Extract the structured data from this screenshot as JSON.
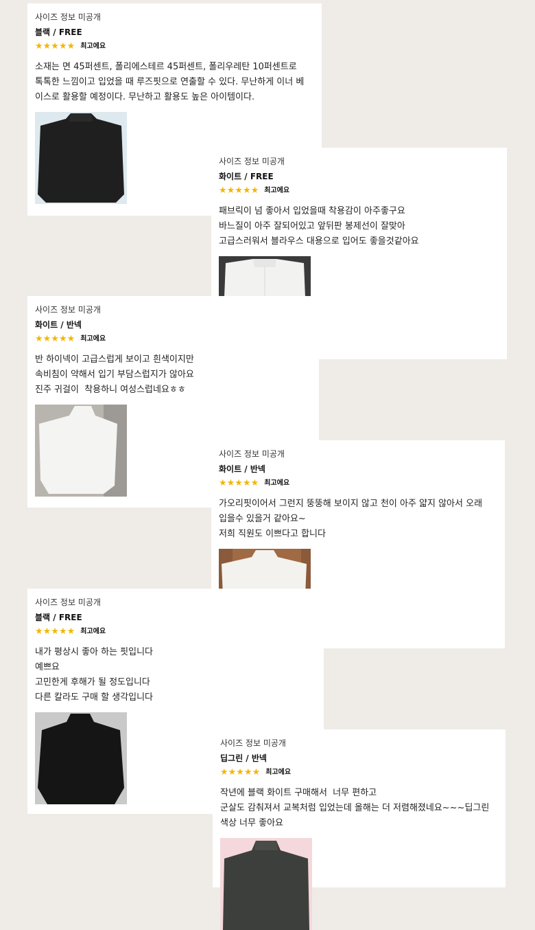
{
  "reviews": [
    {
      "size_info": "사이즈 정보 미공개",
      "option": "블랙 / FREE",
      "stars": "★★★★★",
      "rating_label": "최고에요",
      "text": "소재는 면 45퍼센트, 폴리에스테르 45퍼센트, 폴리우레탄 10퍼센트로\n톡톡한 느낌이고 입었을 때 루즈핏으로 연출할 수 있다. 무난하게 이너 베\n이스로 활용할 예정이다. 무난하고 활용도 높은 아이템이다.",
      "photo": "black-turtleneck-photo"
    },
    {
      "size_info": "사이즈 정보 미공개",
      "option": "화이트 / FREE",
      "stars": "★★★★★",
      "rating_label": "최고에요",
      "text": "패브릭이 넘 좋아서 입었을때 착용감이 아주좋구요\n바느질이 아주 잘되어있고 앞뒤판 봉제선이 잘맞아\n고급스러워서 블라우스 대용으로 입어도 좋을것같아요",
      "photo": "white-top-photo"
    },
    {
      "size_info": "사이즈 정보 미공개",
      "option": "화이트 / 반넥",
      "stars": "★★★★★",
      "rating_label": "최고에요",
      "text": "반 하이넥이 고급스럽게 보이고 흰색이지만\n속비침이 약해서 입기 부담스럽지가 않아요\n진주 귀걸이  착용하니 여성스럽네요ㅎㅎ",
      "photo": "white-top-photo"
    },
    {
      "size_info": "사이즈 정보 미공개",
      "option": "화이트 / 반넥",
      "stars": "★★★★★",
      "rating_label": "최고에요",
      "text": "가오리핏이어서 그런지 뚱뚱해 보이지 않고 천이 아주 얇지 않아서 오래\n입을수 있을거 같아요~\n저희 직원도 이쁘다고 합니다",
      "photo": "white-top-photo"
    },
    {
      "size_info": "사이즈 정보 미공개",
      "option": "블랙 / FREE",
      "stars": "★★★★★",
      "rating_label": "최고에요",
      "text": "내가 평상시 좋아 하는 핏입니다\n예쁘요\n고민한게 후해가 될 정도입니다\n다른 칼라도 구매 할 생각입니다",
      "photo": "black-turtleneck-photo"
    },
    {
      "size_info": "사이즈 정보 미공개",
      "option": "딥그린 / 반넥",
      "stars": "★★★★★",
      "rating_label": "최고에요",
      "text": "작년에 블랙 화이트 구매해서  너무 편하고\n군살도 감춰져서 교복처럼 입었는데 올해는 더 저렴해졌네요~~~딥그린\n색상 너무 좋아요",
      "photo": "deep-green-top-photo"
    }
  ]
}
